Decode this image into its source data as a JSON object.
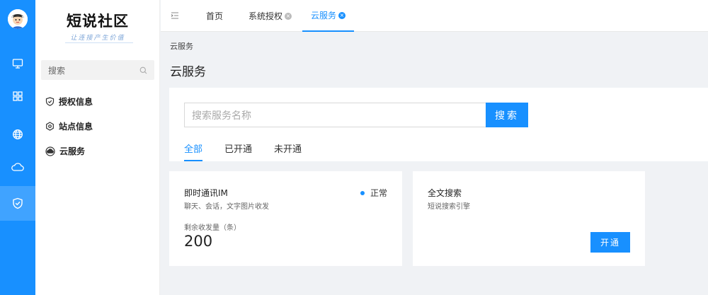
{
  "sidebar": {
    "logo": "短说社区",
    "slogan": "让连接产生价值",
    "search_placeholder": "搜索",
    "items": [
      {
        "label": "授权信息",
        "icon": "shield-check-icon"
      },
      {
        "label": "站点信息",
        "icon": "hexagon-settings-icon"
      },
      {
        "label": "云服务",
        "icon": "cloud-circle-icon"
      }
    ]
  },
  "rail": {
    "icons": [
      "avatar",
      "monitor-icon",
      "grid-icon",
      "globe-icon",
      "cloud-icon",
      "shield-check-icon"
    ],
    "active": "shield-check-icon",
    "accent": "#1890ff"
  },
  "tabs": [
    {
      "label": "首页",
      "closable": false
    },
    {
      "label": "系统授权",
      "closable": true
    },
    {
      "label": "云服务",
      "closable": true,
      "active": true
    }
  ],
  "breadcrumb": "云服务",
  "page_title": "云服务",
  "search": {
    "placeholder": "搜索服务名称",
    "button_label": "搜索"
  },
  "filters": [
    {
      "label": "全部",
      "active": true
    },
    {
      "label": "已开通"
    },
    {
      "label": "未开通"
    }
  ],
  "cards": [
    {
      "name": "即时通讯IM",
      "desc": "聊天、会话，文字图片收发",
      "status": "正常",
      "quota_label": "剩余收发量（条）",
      "quota_value": "200"
    },
    {
      "name": "全文搜索",
      "desc": "短说搜索引擎",
      "action_label": "开通"
    }
  ]
}
